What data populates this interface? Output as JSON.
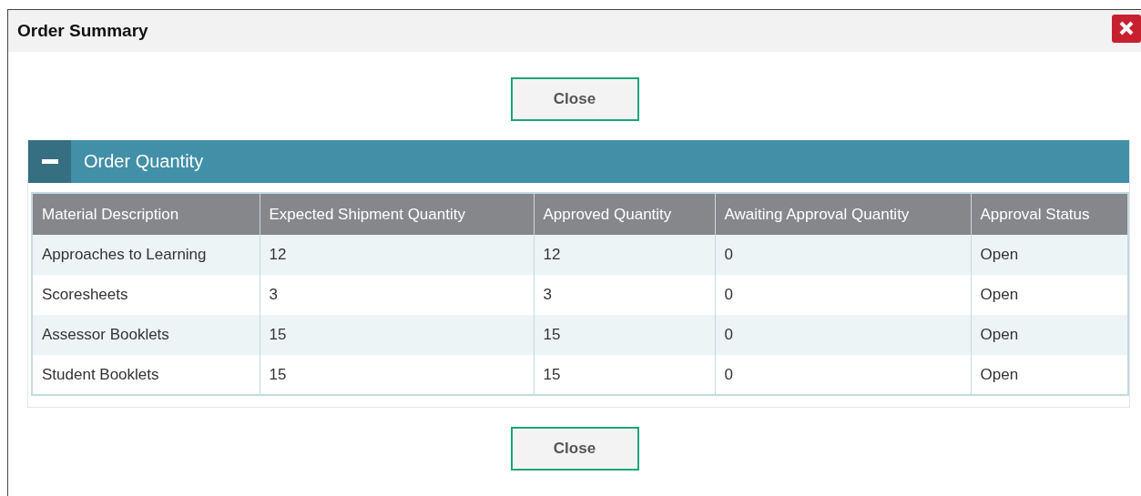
{
  "dialog": {
    "title": "Order Summary"
  },
  "top_button": "Close",
  "section": {
    "title": "Order Quantity",
    "expanded": true,
    "table": {
      "columns": [
        "Material Description",
        "Expected Shipment Quantity",
        "Approved Quantity",
        "Awaiting Approval Quantity",
        "Approval Status"
      ],
      "rows": [
        [
          "Approaches to Learning",
          "12",
          "12",
          "0",
          "Open"
        ],
        [
          "Scoresheets",
          "3",
          "3",
          "0",
          "Open"
        ],
        [
          "Assessor Booklets",
          "15",
          "15",
          "0",
          "Open"
        ],
        [
          "Student Booklets",
          "15",
          "15",
          "0",
          "Open"
        ]
      ]
    }
  },
  "bottom_button": "Close"
}
